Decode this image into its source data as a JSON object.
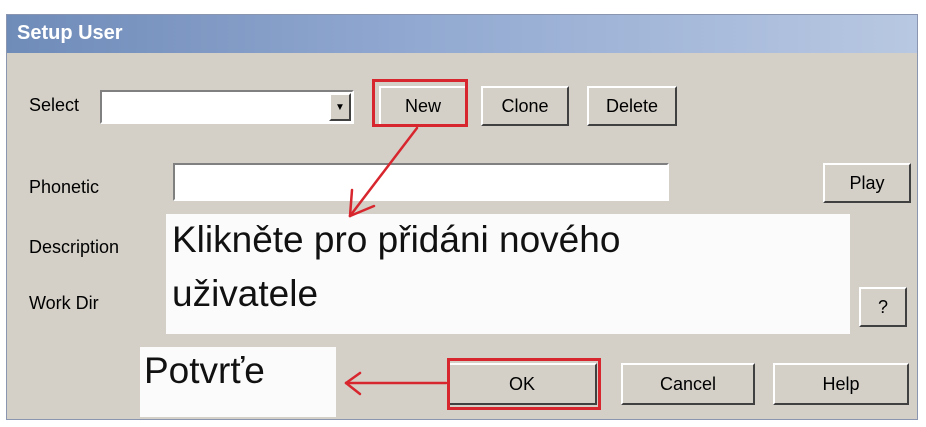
{
  "dialog": {
    "title": "Setup User"
  },
  "select": {
    "label": "Select",
    "value": ""
  },
  "buttons": {
    "new": "New",
    "clone": "Clone",
    "delete": "Delete",
    "play": "Play",
    "browse": "?",
    "ok": "OK",
    "cancel": "Cancel",
    "help": "Help"
  },
  "fields": {
    "phonetic_label": "Phonetic",
    "phonetic_value": "",
    "description_label": "Description",
    "workdir_label": "Work Dir"
  },
  "annotations": {
    "new_note_line1": "Klikněte pro přidáni nového",
    "new_note_line2": "uživatele",
    "ok_note": "Potvrťe",
    "highlight_color": "#d8262e"
  }
}
